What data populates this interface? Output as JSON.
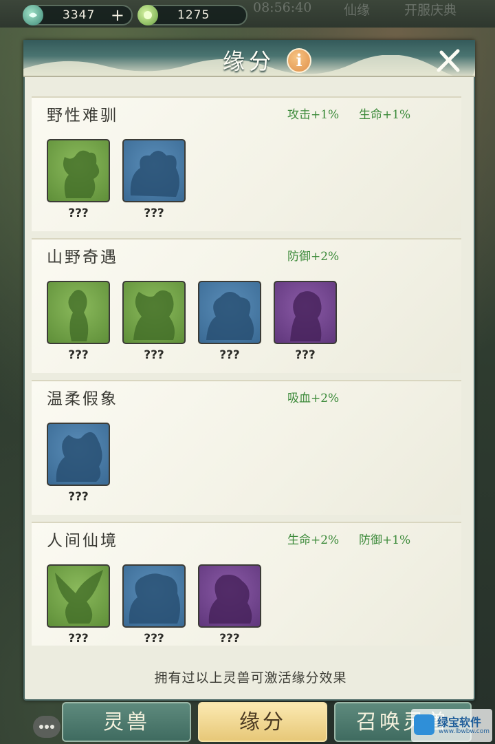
{
  "top_bar": {
    "hidden_time": "08:56:40",
    "hidden_label_1": "仙缘",
    "hidden_label_2": "开服庆典",
    "currency_1": {
      "icon": "jade-coin-icon",
      "value": "3347"
    },
    "currency_2": {
      "icon": "spirit-gem-icon",
      "value": "1275"
    },
    "plus_label": "+"
  },
  "panel": {
    "title": "缘分",
    "info_label": "i",
    "groups": [
      {
        "title": "野性难驯",
        "bonuses": [
          "攻击+1%",
          "生命+1%"
        ],
        "beasts": [
          {
            "name": "???",
            "color": "green"
          },
          {
            "name": "???",
            "color": "blue"
          }
        ]
      },
      {
        "title": "山野奇遇",
        "bonuses": [
          "防御+2%"
        ],
        "beasts": [
          {
            "name": "???",
            "color": "green"
          },
          {
            "name": "???",
            "color": "green"
          },
          {
            "name": "???",
            "color": "blue"
          },
          {
            "name": "???",
            "color": "purple"
          }
        ]
      },
      {
        "title": "温柔假象",
        "bonuses": [
          "吸血+2%"
        ],
        "beasts": [
          {
            "name": "???",
            "color": "blue"
          }
        ]
      },
      {
        "title": "人间仙境",
        "bonuses": [
          "生命+2%",
          "防御+1%"
        ],
        "beasts": [
          {
            "name": "???",
            "color": "green"
          },
          {
            "name": "???",
            "color": "blue"
          },
          {
            "name": "???",
            "color": "purple"
          }
        ]
      }
    ],
    "footer_note": "拥有过以上灵兽可激活缘分效果"
  },
  "tabs": {
    "spirit_beast": "灵兽",
    "fate": "缘分",
    "summon": "召唤灵兽"
  },
  "watermark": {
    "text": "绿宝软件",
    "sub": "www.lbwbw.com"
  },
  "colors": {
    "bonus_green": "#3c8a3a",
    "rarity_green": "#6f9f45",
    "rarity_blue": "#4a7ca6",
    "rarity_purple": "#70458c",
    "active_tab": "#f0d792"
  }
}
